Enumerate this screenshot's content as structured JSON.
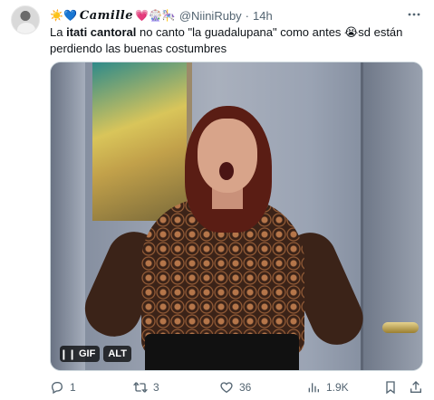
{
  "author": {
    "name_prefix_emojis": "☀️💙",
    "display_name": "Camille",
    "name_suffix_emojis": "💗🎡🎠",
    "handle": "@NiiniRuby",
    "separator": "·",
    "time": "14h"
  },
  "tweet": {
    "text_part1": "La ",
    "text_bold": "itati cantoral",
    "text_part2": " no canto \"la guadalupana\" como antes ",
    "text_emoji": "😭",
    "text_part3": "sd están perdiendo las buenas costumbres"
  },
  "media": {
    "pause_label": "❙❙",
    "gif_label": "GIF",
    "alt_label": "ALT"
  },
  "actions": {
    "replies": "1",
    "retweets": "3",
    "likes": "36",
    "views": "1.9K"
  },
  "icons": {
    "more": "more-icon",
    "reply": "reply-icon",
    "retweet": "retweet-icon",
    "like": "heart-icon",
    "views": "views-icon",
    "bookmark": "bookmark-icon",
    "share": "share-icon"
  }
}
